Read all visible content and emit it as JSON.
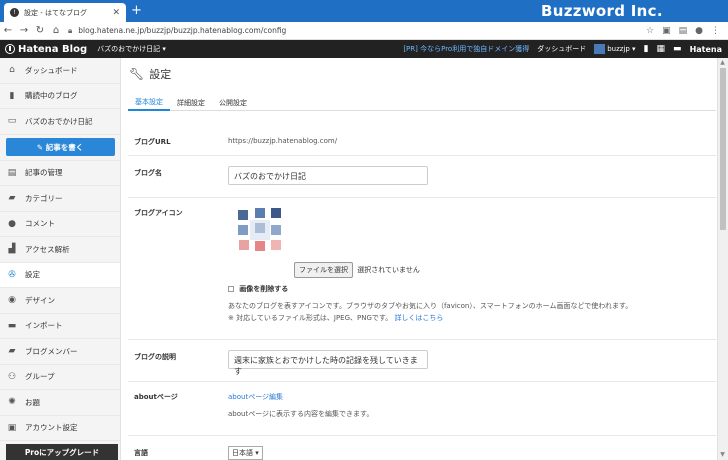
{
  "browser": {
    "tab_title": "設定 - はてなブログ",
    "tab_close": "✕",
    "new_tab": "+",
    "brand": "Buzzword Inc.",
    "url": "blog.hatena.ne.jp/buzzjp/buzzjp.hatenablog.com/config"
  },
  "header": {
    "logo": "Hatena Blog",
    "blog_selector": "バズのおでかけ日記 ▾",
    "promo": "[PR] 今ならPro利用で独自ドメイン獲得",
    "dashboard": "ダッシュボード",
    "user": "buzzjp ▾",
    "hatena": "Hatena"
  },
  "sidebar": {
    "items": [
      {
        "label": "ダッシュボード",
        "icon": "home-icon"
      },
      {
        "label": "購読中のブログ",
        "icon": "bookmark-icon"
      },
      {
        "label": "バズのおでかけ日記",
        "icon": "blog-icon"
      },
      {
        "label": "記事の管理",
        "icon": "article-icon"
      },
      {
        "label": "カテゴリー",
        "icon": "folder-icon"
      },
      {
        "label": "コメント",
        "icon": "comment-icon"
      },
      {
        "label": "アクセス解析",
        "icon": "chart-icon"
      },
      {
        "label": "設定",
        "icon": "wrench-icon"
      },
      {
        "label": "デザイン",
        "icon": "palette-icon"
      },
      {
        "label": "インポート",
        "icon": "import-icon"
      },
      {
        "label": "ブログメンバー",
        "icon": "members-icon"
      },
      {
        "label": "グループ",
        "icon": "group-icon"
      },
      {
        "label": "お題",
        "icon": "theme-icon"
      },
      {
        "label": "アカウント設定",
        "icon": "account-icon"
      }
    ],
    "write_button": "記事を書く",
    "upgrade": "Proにアップグレード"
  },
  "main": {
    "title": "設定",
    "tabs": [
      "基本設定",
      "詳細設定",
      "公開設定"
    ],
    "blog_url": {
      "label": "ブログURL",
      "value": "https://buzzjp.hatenablog.com/"
    },
    "blog_name": {
      "label": "ブログ名",
      "value": "バズのおでかけ日記"
    },
    "blog_icon": {
      "label": "ブログアイコン",
      "file_button": "ファイルを選択",
      "file_status": "選択されていません",
      "delete_label": "画像を削除する",
      "desc1": "あなたのブログを表すアイコンです。ブラウザのタブやお気に入り（favicon）、スマートフォンのホーム画面などで使われます。",
      "desc2": "※ 対応しているファイル形式は、JPEG、PNGです。",
      "desc_link": "詳しくはこちら"
    },
    "blog_desc": {
      "label": "ブログの説明",
      "value": "週末に家族とおでかけした時の記録を残していきます"
    },
    "about": {
      "label": "aboutページ",
      "link": "aboutページ編集",
      "note": "aboutページに表示する内容を編集できます。"
    },
    "language": {
      "label": "言語",
      "value": "日本語 ▾"
    }
  }
}
